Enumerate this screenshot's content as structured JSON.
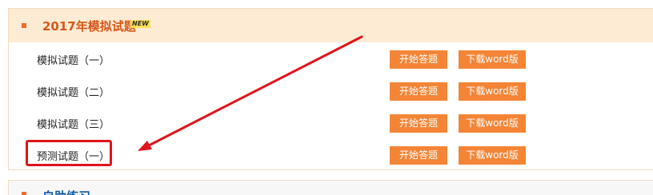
{
  "section": {
    "title": "2017年模拟试题",
    "badge": "NEW"
  },
  "rows": [
    {
      "label": "模拟试题（一）",
      "start_label": "开始答题",
      "download_label": "下载word版"
    },
    {
      "label": "模拟试题（二）",
      "start_label": "开始答题",
      "download_label": "下载word版"
    },
    {
      "label": "模拟试题（三）",
      "start_label": "开始答题",
      "download_label": "下载word版"
    },
    {
      "label": "预测试题（一）",
      "start_label": "开始答题",
      "download_label": "下载word版"
    }
  ],
  "section2": {
    "title": "自助练习"
  },
  "colors": {
    "accent": "#f48536",
    "header_bg": "#fdebd3",
    "annotation": "#e0141a"
  }
}
